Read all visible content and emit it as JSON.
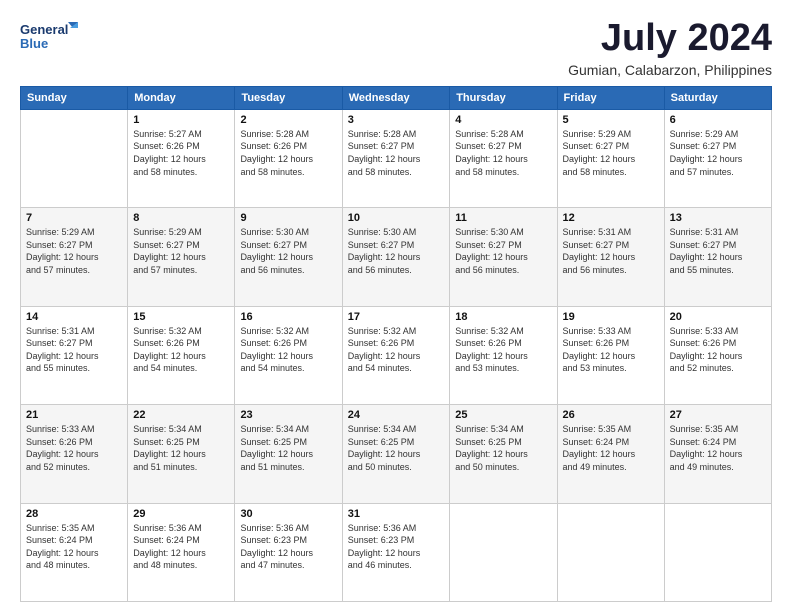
{
  "header": {
    "logo_line1": "General",
    "logo_line2": "Blue",
    "title": "July 2024",
    "subtitle": "Gumian, Calabarzon, Philippines"
  },
  "days_of_week": [
    "Sunday",
    "Monday",
    "Tuesday",
    "Wednesday",
    "Thursday",
    "Friday",
    "Saturday"
  ],
  "weeks": [
    [
      {
        "day": "",
        "info": ""
      },
      {
        "day": "1",
        "info": "Sunrise: 5:27 AM\nSunset: 6:26 PM\nDaylight: 12 hours\nand 58 minutes."
      },
      {
        "day": "2",
        "info": "Sunrise: 5:28 AM\nSunset: 6:26 PM\nDaylight: 12 hours\nand 58 minutes."
      },
      {
        "day": "3",
        "info": "Sunrise: 5:28 AM\nSunset: 6:27 PM\nDaylight: 12 hours\nand 58 minutes."
      },
      {
        "day": "4",
        "info": "Sunrise: 5:28 AM\nSunset: 6:27 PM\nDaylight: 12 hours\nand 58 minutes."
      },
      {
        "day": "5",
        "info": "Sunrise: 5:29 AM\nSunset: 6:27 PM\nDaylight: 12 hours\nand 58 minutes."
      },
      {
        "day": "6",
        "info": "Sunrise: 5:29 AM\nSunset: 6:27 PM\nDaylight: 12 hours\nand 57 minutes."
      }
    ],
    [
      {
        "day": "7",
        "info": "Sunrise: 5:29 AM\nSunset: 6:27 PM\nDaylight: 12 hours\nand 57 minutes."
      },
      {
        "day": "8",
        "info": "Sunrise: 5:29 AM\nSunset: 6:27 PM\nDaylight: 12 hours\nand 57 minutes."
      },
      {
        "day": "9",
        "info": "Sunrise: 5:30 AM\nSunset: 6:27 PM\nDaylight: 12 hours\nand 56 minutes."
      },
      {
        "day": "10",
        "info": "Sunrise: 5:30 AM\nSunset: 6:27 PM\nDaylight: 12 hours\nand 56 minutes."
      },
      {
        "day": "11",
        "info": "Sunrise: 5:30 AM\nSunset: 6:27 PM\nDaylight: 12 hours\nand 56 minutes."
      },
      {
        "day": "12",
        "info": "Sunrise: 5:31 AM\nSunset: 6:27 PM\nDaylight: 12 hours\nand 56 minutes."
      },
      {
        "day": "13",
        "info": "Sunrise: 5:31 AM\nSunset: 6:27 PM\nDaylight: 12 hours\nand 55 minutes."
      }
    ],
    [
      {
        "day": "14",
        "info": "Sunrise: 5:31 AM\nSunset: 6:27 PM\nDaylight: 12 hours\nand 55 minutes."
      },
      {
        "day": "15",
        "info": "Sunrise: 5:32 AM\nSunset: 6:26 PM\nDaylight: 12 hours\nand 54 minutes."
      },
      {
        "day": "16",
        "info": "Sunrise: 5:32 AM\nSunset: 6:26 PM\nDaylight: 12 hours\nand 54 minutes."
      },
      {
        "day": "17",
        "info": "Sunrise: 5:32 AM\nSunset: 6:26 PM\nDaylight: 12 hours\nand 54 minutes."
      },
      {
        "day": "18",
        "info": "Sunrise: 5:32 AM\nSunset: 6:26 PM\nDaylight: 12 hours\nand 53 minutes."
      },
      {
        "day": "19",
        "info": "Sunrise: 5:33 AM\nSunset: 6:26 PM\nDaylight: 12 hours\nand 53 minutes."
      },
      {
        "day": "20",
        "info": "Sunrise: 5:33 AM\nSunset: 6:26 PM\nDaylight: 12 hours\nand 52 minutes."
      }
    ],
    [
      {
        "day": "21",
        "info": "Sunrise: 5:33 AM\nSunset: 6:26 PM\nDaylight: 12 hours\nand 52 minutes."
      },
      {
        "day": "22",
        "info": "Sunrise: 5:34 AM\nSunset: 6:25 PM\nDaylight: 12 hours\nand 51 minutes."
      },
      {
        "day": "23",
        "info": "Sunrise: 5:34 AM\nSunset: 6:25 PM\nDaylight: 12 hours\nand 51 minutes."
      },
      {
        "day": "24",
        "info": "Sunrise: 5:34 AM\nSunset: 6:25 PM\nDaylight: 12 hours\nand 50 minutes."
      },
      {
        "day": "25",
        "info": "Sunrise: 5:34 AM\nSunset: 6:25 PM\nDaylight: 12 hours\nand 50 minutes."
      },
      {
        "day": "26",
        "info": "Sunrise: 5:35 AM\nSunset: 6:24 PM\nDaylight: 12 hours\nand 49 minutes."
      },
      {
        "day": "27",
        "info": "Sunrise: 5:35 AM\nSunset: 6:24 PM\nDaylight: 12 hours\nand 49 minutes."
      }
    ],
    [
      {
        "day": "28",
        "info": "Sunrise: 5:35 AM\nSunset: 6:24 PM\nDaylight: 12 hours\nand 48 minutes."
      },
      {
        "day": "29",
        "info": "Sunrise: 5:36 AM\nSunset: 6:24 PM\nDaylight: 12 hours\nand 48 minutes."
      },
      {
        "day": "30",
        "info": "Sunrise: 5:36 AM\nSunset: 6:23 PM\nDaylight: 12 hours\nand 47 minutes."
      },
      {
        "day": "31",
        "info": "Sunrise: 5:36 AM\nSunset: 6:23 PM\nDaylight: 12 hours\nand 46 minutes."
      },
      {
        "day": "",
        "info": ""
      },
      {
        "day": "",
        "info": ""
      },
      {
        "day": "",
        "info": ""
      }
    ]
  ]
}
